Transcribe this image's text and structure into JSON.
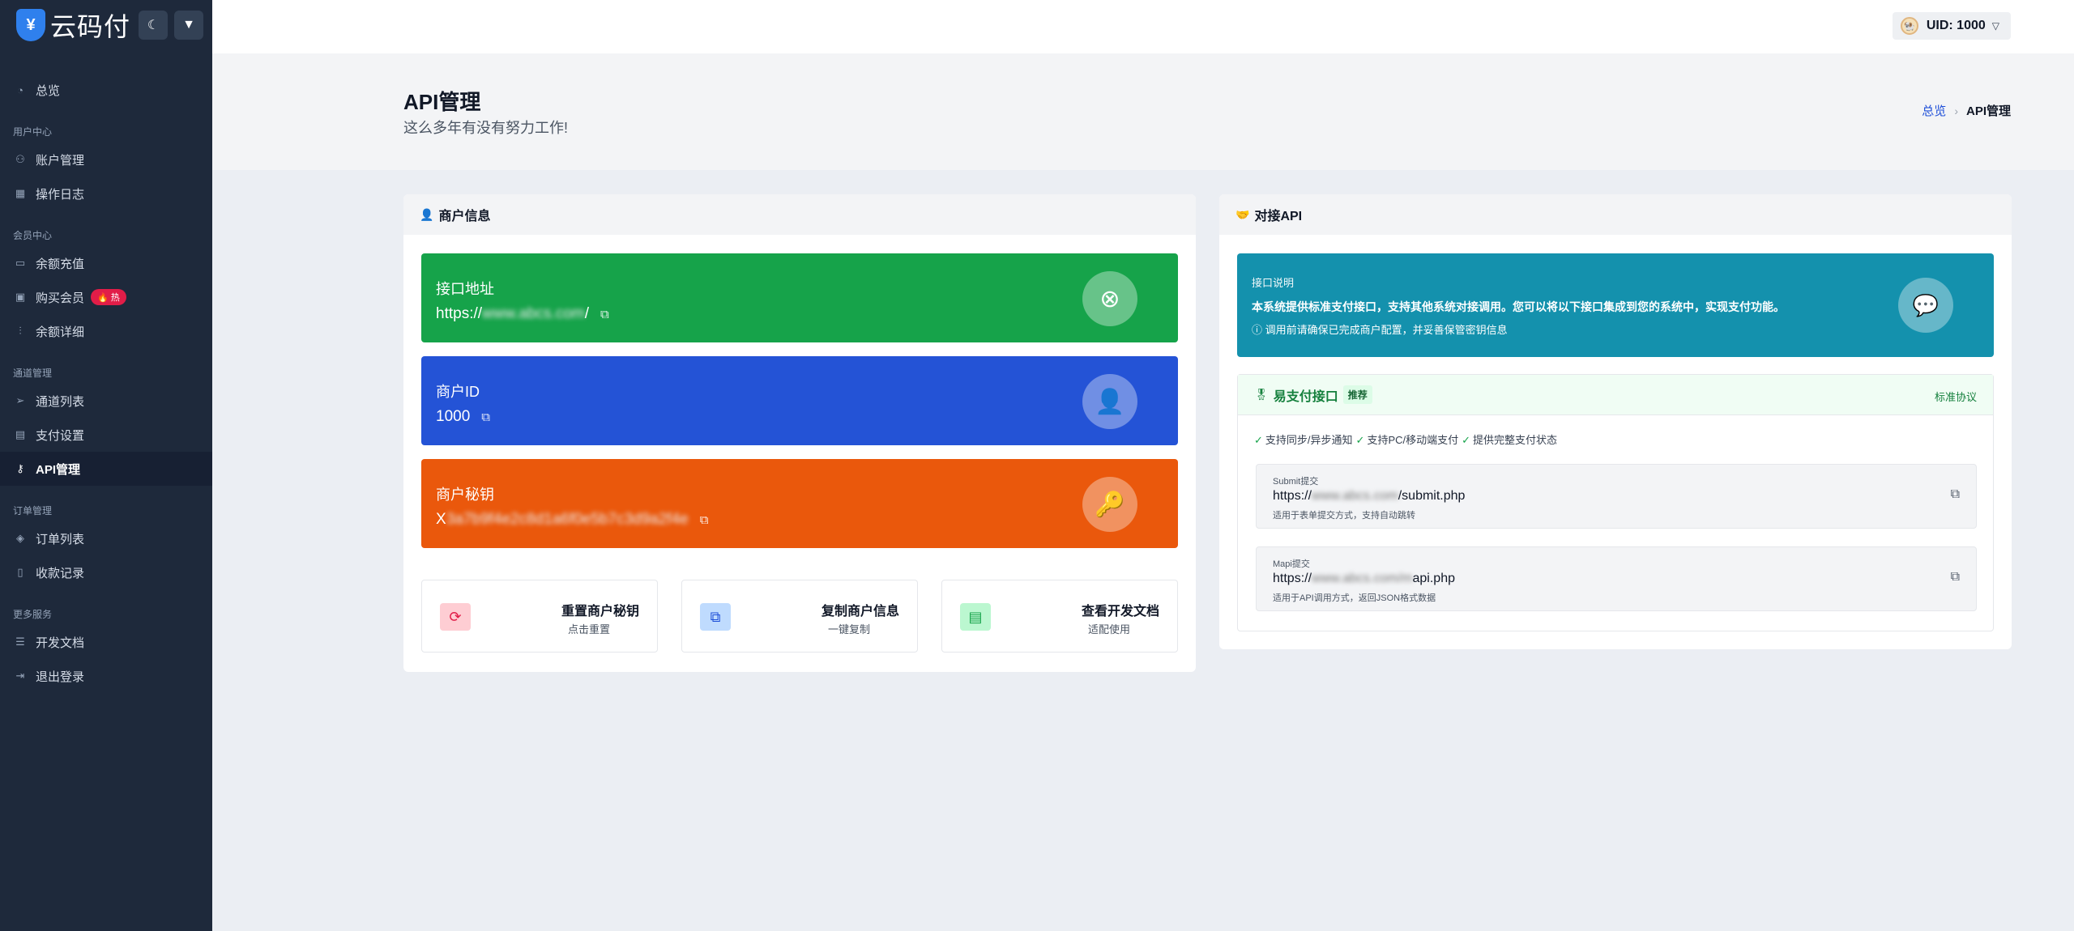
{
  "brand": {
    "name": "云码付",
    "logo_glyph": "¥"
  },
  "sidebar": {
    "top": {
      "label": "总览"
    },
    "sections": [
      {
        "title": "用户中心",
        "items": [
          {
            "label": "账户管理",
            "icon": "user-icon"
          },
          {
            "label": "操作日志",
            "icon": "calendar-icon"
          }
        ]
      },
      {
        "title": "会员中心",
        "items": [
          {
            "label": "余额充值",
            "icon": "wallet-icon"
          },
          {
            "label": "购买会员",
            "icon": "gift-icon",
            "badge": "热"
          },
          {
            "label": "余额详细",
            "icon": "sliders-icon"
          }
        ]
      },
      {
        "title": "通道管理",
        "items": [
          {
            "label": "通道列表",
            "icon": "send-icon"
          },
          {
            "label": "支付设置",
            "icon": "grid-icon"
          },
          {
            "label": "API管理",
            "icon": "key-icon",
            "active": true
          }
        ]
      },
      {
        "title": "订单管理",
        "items": [
          {
            "label": "订单列表",
            "icon": "layers-icon"
          },
          {
            "label": "收款记录",
            "icon": "receipt-icon"
          }
        ]
      },
      {
        "title": "更多服务",
        "items": [
          {
            "label": "开发文档",
            "icon": "doc-icon"
          },
          {
            "label": "退出登录",
            "icon": "logout-icon"
          }
        ]
      }
    ]
  },
  "user": {
    "label": "UID: 1000"
  },
  "header": {
    "title": "API管理",
    "subtitle": "这么多年有没有努力工作!"
  },
  "breadcrumb": {
    "home": "总览",
    "current": "API管理"
  },
  "merchant": {
    "title": "商户信息",
    "api_label": "接口地址",
    "api_prefix": "https://",
    "api_masked": "www.abcs.com",
    "api_suffix": "/",
    "id_label": "商户ID",
    "id_value": "1000",
    "key_label": "商户秘钥",
    "key_prefix": "X",
    "key_masked": "3a7b9f4e2c8d1a6f0e5b7c3d9a2f4e",
    "colors": {
      "api": "#16a34a",
      "id": "#2453d6",
      "key": "#ea580c"
    }
  },
  "actions": [
    {
      "title": "重置商户秘钥",
      "sub": "点击重置"
    },
    {
      "title": "复制商户信息",
      "sub": "一键复制"
    },
    {
      "title": "查看开发文档",
      "sub": "适配使用"
    }
  ],
  "api": {
    "title": "对接API",
    "info_title": "接口说明",
    "info_desc": "本系统提供标准支付接口，支持其他系统对接调用。您可以将以下接口集成到您的系统中，实现支付功能。",
    "info_tip": "调用前请确保已完成商户配置，并妥善保管密钥信息",
    "epay_title": "易支付接口",
    "epay_badge": "推荐",
    "epay_link": "标准协议",
    "features": [
      "支持同步/异步通知",
      "支持PC/移动端支付",
      "提供完整支付状态"
    ],
    "submit": {
      "label": "Submit提交",
      "prefix": "https://",
      "masked": "www.abcs.com",
      "suffix": "/submit.php",
      "note": "适用于表单提交方式，支持自动跳转"
    },
    "mapi": {
      "label": "Mapi提交",
      "prefix": "https://",
      "masked": "www.abcs.com/m",
      "suffix": "api.php",
      "note": "适用于API调用方式，返回JSON格式数据"
    }
  }
}
